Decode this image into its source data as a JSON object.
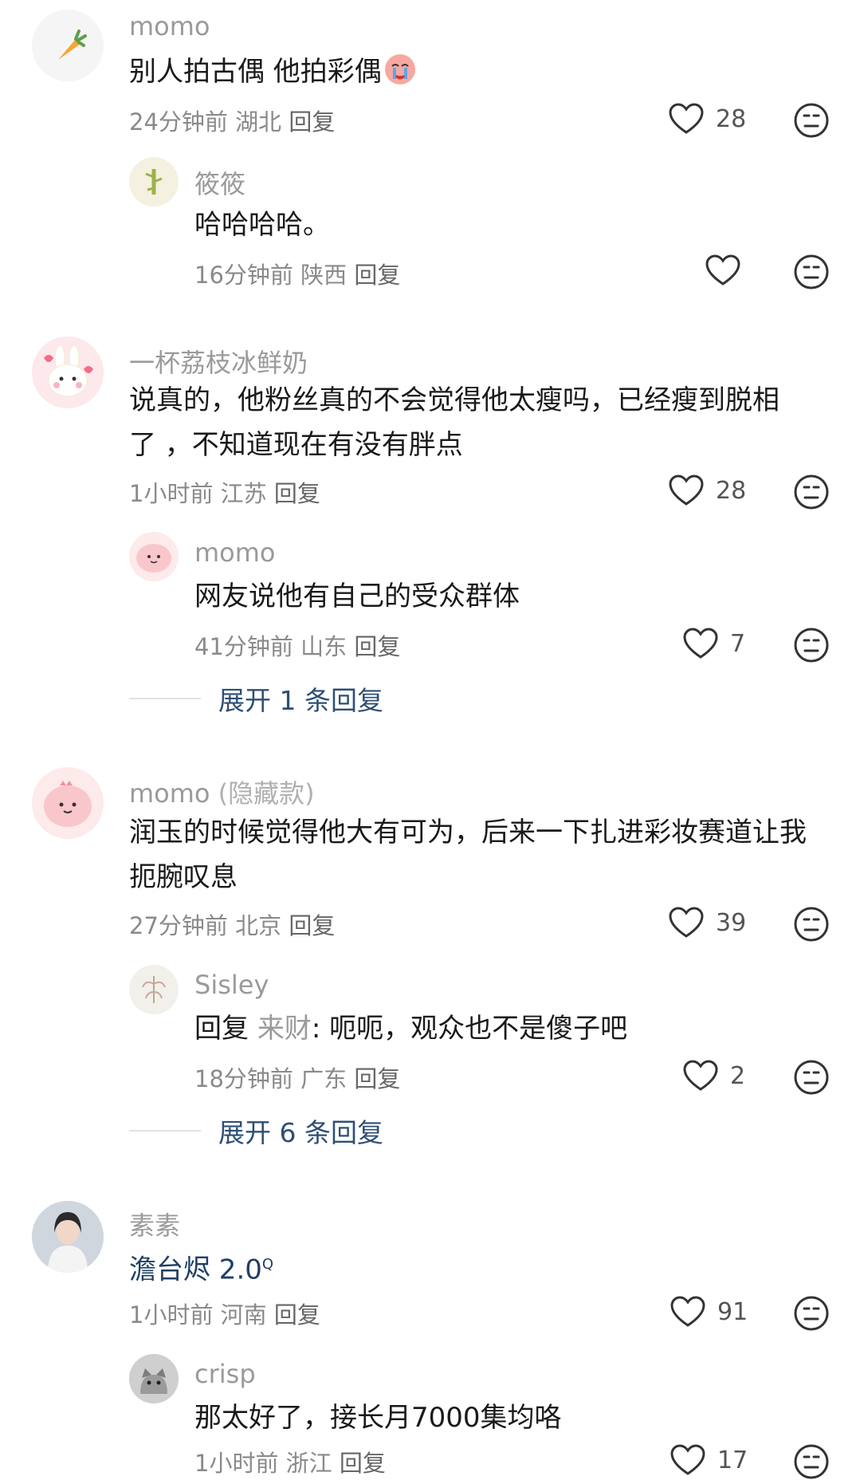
{
  "comments": [
    {
      "user": "momo",
      "text": "别人拍古偶 他拍彩偶",
      "emoji": "crying-face-emoji",
      "time": "24分钟前",
      "location": "湖北",
      "reply": "回复",
      "likes": "28",
      "avatar": "carrot-icon"
    },
    {
      "user": "筱筱",
      "text": "哈哈哈哈。",
      "time": "16分钟前",
      "location": "陕西",
      "reply": "回复",
      "likes": "",
      "avatar": "bamboo-icon"
    },
    {
      "user": "一杯荔枝冰鲜奶",
      "text_line1": "说真的，他粉丝真的不会觉得他太瘦吗，已经瘦到脱相",
      "text_line2": "了 ，不知道现在有没有胖点",
      "time": "1小时前",
      "location": "江苏",
      "reply": "回复",
      "likes": "28",
      "avatar": "bunny-icon"
    },
    {
      "user": "momo",
      "text": "网友说他有自己的受众群体",
      "time": "41分钟前",
      "location": "山东",
      "reply": "回复",
      "likes": "7",
      "avatar": "pink-blob-icon"
    },
    {
      "user": "momo",
      "user_suffix": "(隐藏款)",
      "text_line1": "润玉的时候觉得他大有可为，后来一下扎进彩妆赛道让我",
      "text_line2": "扼腕叹息",
      "time": "27分钟前",
      "location": "北京",
      "reply": "回复",
      "likes": "39",
      "avatar": "pink-blob-icon"
    },
    {
      "user": "Sisley",
      "reply_prefix": "回复",
      "reply_target": "来财",
      "text": ": 呃呃，观众也不是傻子吧",
      "time": "18分钟前",
      "location": "广东",
      "reply": "回复",
      "likes": "2",
      "avatar": "flower-icon"
    },
    {
      "user": "素素",
      "text": "澹台烬 2.0",
      "text_sup": "Q",
      "time": "1小时前",
      "location": "河南",
      "reply": "回复",
      "likes": "91",
      "avatar": "portrait-icon"
    },
    {
      "user": "crisp",
      "text": "那太好了，接长月7000集均咯",
      "time": "1小时前",
      "location": "浙江",
      "reply": "回复",
      "likes": "17",
      "avatar": "cat-icon"
    }
  ],
  "expand": [
    {
      "label": "展开 1 条回复"
    },
    {
      "label": "展开 6 条回复"
    }
  ],
  "colors": {
    "username": "#9a9a9a",
    "text": "#1a1a1a",
    "meta": "#8a8a8a",
    "expand": "#2f4f75"
  }
}
